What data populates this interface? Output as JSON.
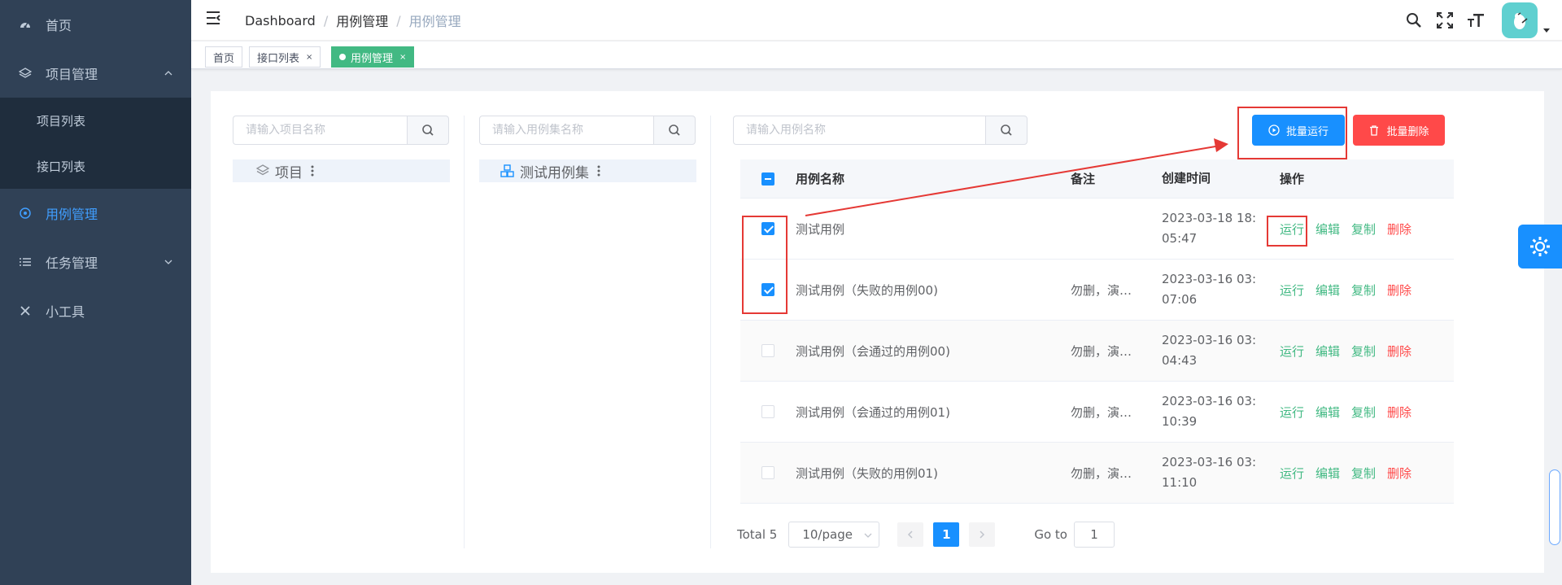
{
  "sidebar": {
    "items": [
      {
        "label": "首页"
      },
      {
        "label": "项目管理"
      },
      {
        "label": "项目列表"
      },
      {
        "label": "接口列表"
      },
      {
        "label": "用例管理"
      },
      {
        "label": "任务管理"
      },
      {
        "label": "小工具"
      }
    ]
  },
  "header": {
    "breadcrumb": [
      "Dashboard",
      "用例管理",
      "用例管理"
    ],
    "breadcrumb_sep": "/"
  },
  "tags": [
    {
      "label": "首页"
    },
    {
      "label": "接口列表",
      "close": "×"
    },
    {
      "label": "用例管理",
      "close": "×"
    }
  ],
  "search": {
    "project_placeholder": "请输入项目名称",
    "suite_placeholder": "请输入用例集名称",
    "case_placeholder": "请输入用例名称"
  },
  "tree": {
    "project_label": "项目",
    "suite_label": "测试用例集"
  },
  "buttons": {
    "batch_run": "批量运行",
    "batch_delete": "批量删除"
  },
  "table": {
    "headers": {
      "name": "用例名称",
      "remark": "备注",
      "created": "创建时间",
      "ops": "操作"
    },
    "op_labels": {
      "run": "运行",
      "edit": "编辑",
      "copy": "复制",
      "delete": "删除"
    },
    "rows": [
      {
        "name": "测试用例",
        "remark": "",
        "time1": "2023-03-18 18:",
        "time2": "05:47",
        "checked": true
      },
      {
        "name": "测试用例（失败的用例00)",
        "remark": "勿删，演…",
        "time1": "2023-03-16 03:",
        "time2": "07:06",
        "checked": true
      },
      {
        "name": "测试用例（会通过的用例00)",
        "remark": "勿删，演…",
        "time1": "2023-03-16 03:",
        "time2": "04:43",
        "checked": false
      },
      {
        "name": "测试用例（会通过的用例01)",
        "remark": "勿删，演…",
        "time1": "2023-03-16 03:",
        "time2": "10:39",
        "checked": false
      },
      {
        "name": "测试用例（失败的用例01)",
        "remark": "勿删，演…",
        "time1": "2023-03-16 03:",
        "time2": "11:10",
        "checked": false
      }
    ]
  },
  "pagination": {
    "total": "Total 5",
    "page_size": "10/page",
    "current": "1",
    "goto_label": "Go to",
    "goto_value": "1"
  },
  "colors": {
    "sidebar_bg": "#304156",
    "primary": "#1890ff",
    "success": "#42b983",
    "danger": "#ff4949",
    "annotation": "#e53935"
  }
}
